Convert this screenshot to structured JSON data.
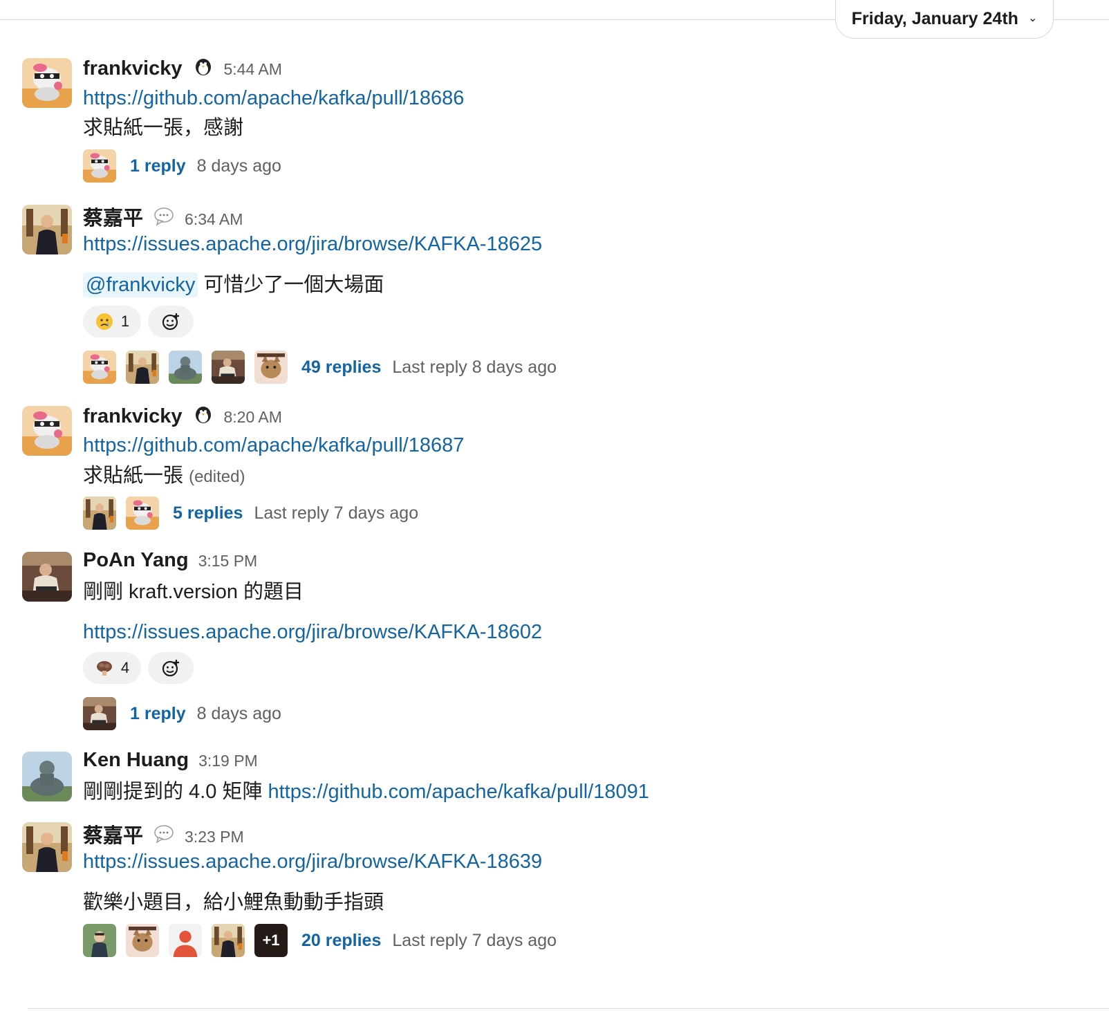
{
  "date_divider": {
    "label": "Friday, January 24th"
  },
  "messages": [
    {
      "user": "frankvicky",
      "time": "5:44 AM",
      "lines": [
        "https://github.com/apache/kafka/pull/18686",
        "求貼紙一張，感謝"
      ],
      "thread": {
        "count": "1 reply",
        "last": "8 days ago"
      }
    },
    {
      "user": "蔡嘉平",
      "time": "6:34 AM",
      "lines": [
        "https://issues.apache.org/jira/browse/KAFKA-18625",
        "@frankvicky",
        "可惜少了一個大場面"
      ],
      "reactions": [
        {
          "emoji": "crying-face",
          "count": "1"
        }
      ],
      "thread": {
        "count": "49 replies",
        "last": "Last reply 8 days ago"
      }
    },
    {
      "user": "frankvicky",
      "time": "8:20 AM",
      "lines": [
        "https://github.com/apache/kafka/pull/18687",
        "求貼紙一張",
        "(edited)"
      ],
      "thread": {
        "count": "5 replies",
        "last": "Last reply 7 days ago"
      }
    },
    {
      "user": "PoAn Yang",
      "time": "3:15 PM",
      "lines": [
        "剛剛 kraft.version 的題目",
        "https://issues.apache.org/jira/browse/KAFKA-18602"
      ],
      "reactions": [
        {
          "emoji": "brain",
          "count": "4"
        }
      ],
      "thread": {
        "count": "1 reply",
        "last": "8 days ago"
      }
    },
    {
      "user": "Ken Huang",
      "time": "3:19 PM",
      "lines": [
        "剛剛提到的 4.0 矩陣",
        "https://github.com/apache/kafka/pull/18091"
      ]
    },
    {
      "user": "蔡嘉平",
      "time": "3:23 PM",
      "lines": [
        "https://issues.apache.org/jira/browse/KAFKA-18639",
        "歡樂小題目，給小鯉魚動動手指頭"
      ],
      "thread": {
        "count": "20 replies",
        "last": "Last reply 7 days ago",
        "more": "+1"
      }
    }
  ],
  "colors": {
    "link": "#1264a3",
    "muted": "#616061",
    "mention_bg": "#e8f5fa",
    "reaction_bg": "#f1f1f1"
  }
}
